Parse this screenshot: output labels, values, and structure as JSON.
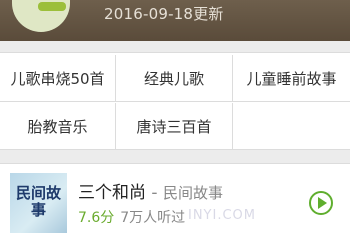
{
  "banner": {
    "date_text": "2016-09-18更新"
  },
  "categories": {
    "items": [
      {
        "label": "儿歌串烧50首"
      },
      {
        "label": "经典儿歌"
      },
      {
        "label": "儿童睡前故事"
      },
      {
        "label": "胎教音乐"
      },
      {
        "label": "唐诗三百首"
      }
    ]
  },
  "story": {
    "cover_text": "民间故事",
    "title": "三个和尚",
    "separator": " - ",
    "category": "民间故事",
    "score": "7.6分",
    "listens": "7万人听过",
    "watermark": "INYI.COM",
    "accent_color": "#5fae2e"
  }
}
